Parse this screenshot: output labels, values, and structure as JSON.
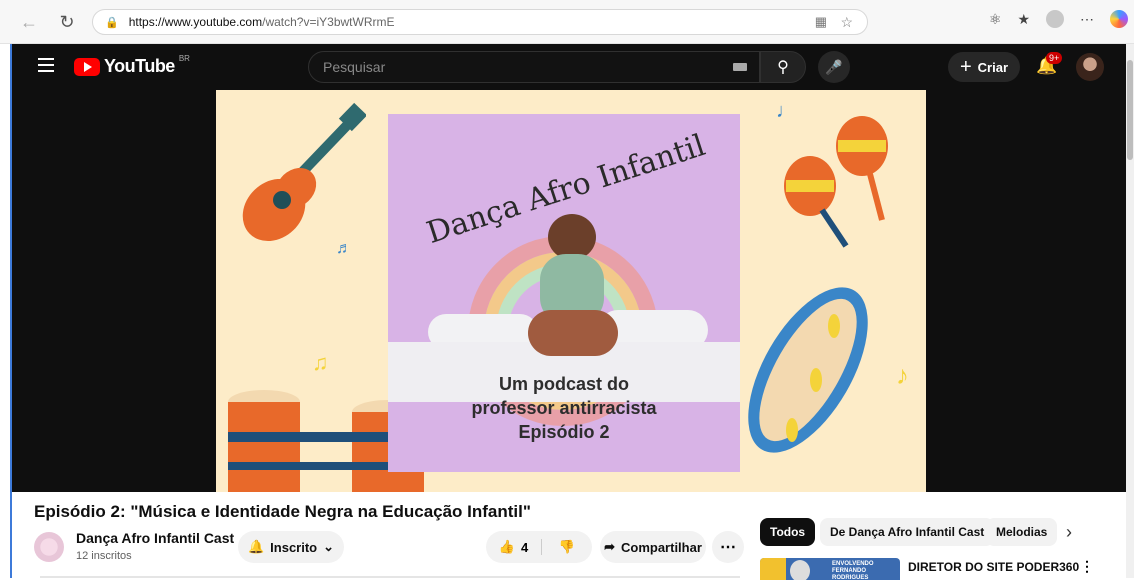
{
  "browser": {
    "url_host": "https://www.youtube.com",
    "url_path": "/watch?v=iY3bwtWRrmE"
  },
  "youtube": {
    "logo_text": "YouTube",
    "logo_region": "BR",
    "search_placeholder": "Pesquisar",
    "create_label": "Criar",
    "notification_badge": "9+"
  },
  "thumbnail": {
    "title": "Dança Afro Infantil",
    "subtitle_line1": "Um podcast do",
    "subtitle_line2": "professor antirracista",
    "subtitle_line3": "Episódio 2"
  },
  "video": {
    "title": "Episódio 2: \"Música e Identidade Negra na Educação Infantil\"",
    "channel_name": "Dança Afro Infantil Cast",
    "subscribers": "12 inscritos",
    "subscribed_label": "Inscrito",
    "likes": "4",
    "share_label": "Compartilhar"
  },
  "chips": [
    "Todos",
    "De Dança Afro Infantil Cast",
    "Melodias"
  ],
  "recommendation": {
    "title": "DIRETOR DO SITE PODER360",
    "thumb_text_line1": "ENVOLVENDO",
    "thumb_text_line2": "FERNANDO RODRIGUES"
  },
  "colors": {
    "youtube_red": "#ff0000",
    "topbar_bg": "#0f0f0f",
    "thumb_bg": "#fdecc8",
    "panel_bg": "#d8b3e6"
  }
}
